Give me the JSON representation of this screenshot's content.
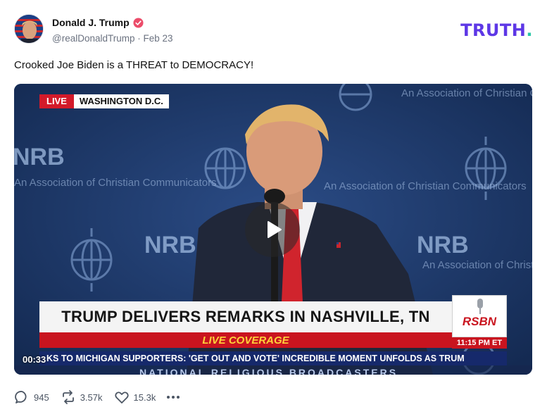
{
  "author": {
    "name": "Donald J. Trump",
    "handle": "@realDonaldTrump",
    "separator": "·",
    "date": "Feb 23",
    "avatar_icon": "avatar-portrait-icon",
    "verified_icon": "verified-badge-icon"
  },
  "brand": {
    "text": "TRUTH",
    "dot": ".",
    "color": "#5d37e6",
    "dot_color": "#27c7a6"
  },
  "post": {
    "text": "Crooked Joe Biden is a THREAT to DEMOCRACY!"
  },
  "video": {
    "live_label": "LIVE",
    "location": "WASHINGTON D.C.",
    "headline": "TRUMP DELIVERS REMARKS IN NASHVILLE, TN",
    "coverage": "LIVE COVERAGE",
    "network": "RSBN",
    "network_time": "11:15 PM ET",
    "ticker": "KS TO MICHIGAN SUPPORTERS: 'GET OUT AND VOTE'   INCREDIBLE MOMENT UNFOLDS AS TRUM",
    "timestamp": "00:33",
    "backdrop_org": "NRB",
    "backdrop_tag": "An Association of Christian Communicators",
    "bottom_banner": "NATIONAL RELIGIOUS BROADCASTERS",
    "play_icon": "play-icon"
  },
  "actions": {
    "replies": "945",
    "retruths": "3.57k",
    "likes": "15.3k",
    "reply_icon": "comment-icon",
    "retruth_icon": "retruth-icon",
    "like_icon": "heart-icon",
    "more_icon": "more-dots-icon"
  }
}
